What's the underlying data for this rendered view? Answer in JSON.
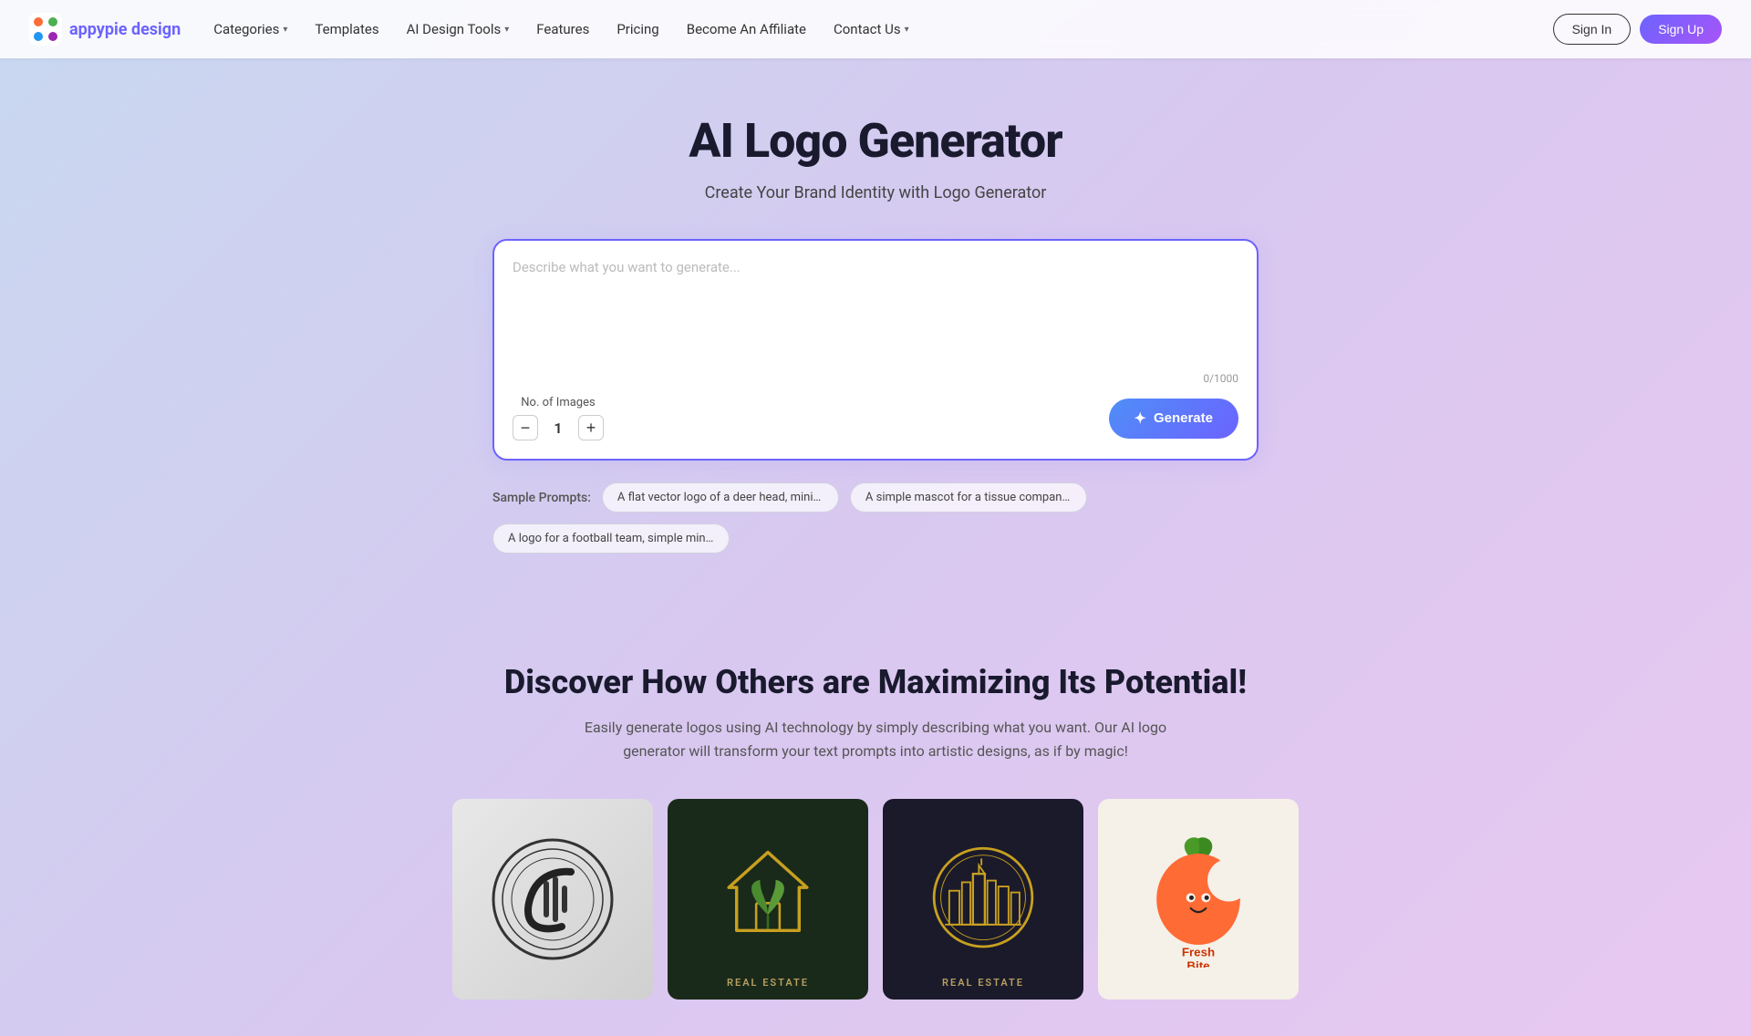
{
  "brand": {
    "name_part1": "appypie",
    "name_part2": " design"
  },
  "navbar": {
    "categories_label": "Categories",
    "templates_label": "Templates",
    "ai_design_tools_label": "AI Design Tools",
    "features_label": "Features",
    "pricing_label": "Pricing",
    "affiliate_label": "Become An Affiliate",
    "contact_label": "Contact Us",
    "signin_label": "Sign In",
    "signup_label": "Sign Up"
  },
  "hero": {
    "title": "AI Logo Generator",
    "subtitle": "Create Your Brand Identity with Logo Generator"
  },
  "generator": {
    "placeholder": "Describe what you want to generate...",
    "char_count": "0/1000",
    "images_label": "No. of Images",
    "counter_value": "1",
    "decrement_label": "−",
    "increment_label": "+",
    "generate_label": "Generate"
  },
  "sample_prompts": {
    "label": "Sample Prompts:",
    "chips": [
      "A flat vector logo of a deer head, minimal grap...",
      "A simple mascot for a tissue company, Japane...",
      "A logo for a football team, simple minimal --no..."
    ]
  },
  "discover": {
    "title": "Discover How Others are Maximizing Its Potential!",
    "description": "Easily generate logos using AI technology by simply describing what you want. Our AI logo generator will transform your text prompts into artistic designs, as if by magic!",
    "cards": [
      {
        "id": "card1",
        "theme": "monogram",
        "label": ""
      },
      {
        "id": "card2",
        "theme": "house-plant",
        "label": "REAL ESTATE"
      },
      {
        "id": "card3",
        "theme": "city-circle",
        "label": "REAL ESTATE"
      },
      {
        "id": "card4",
        "theme": "fresh-bite",
        "label": ""
      }
    ]
  }
}
